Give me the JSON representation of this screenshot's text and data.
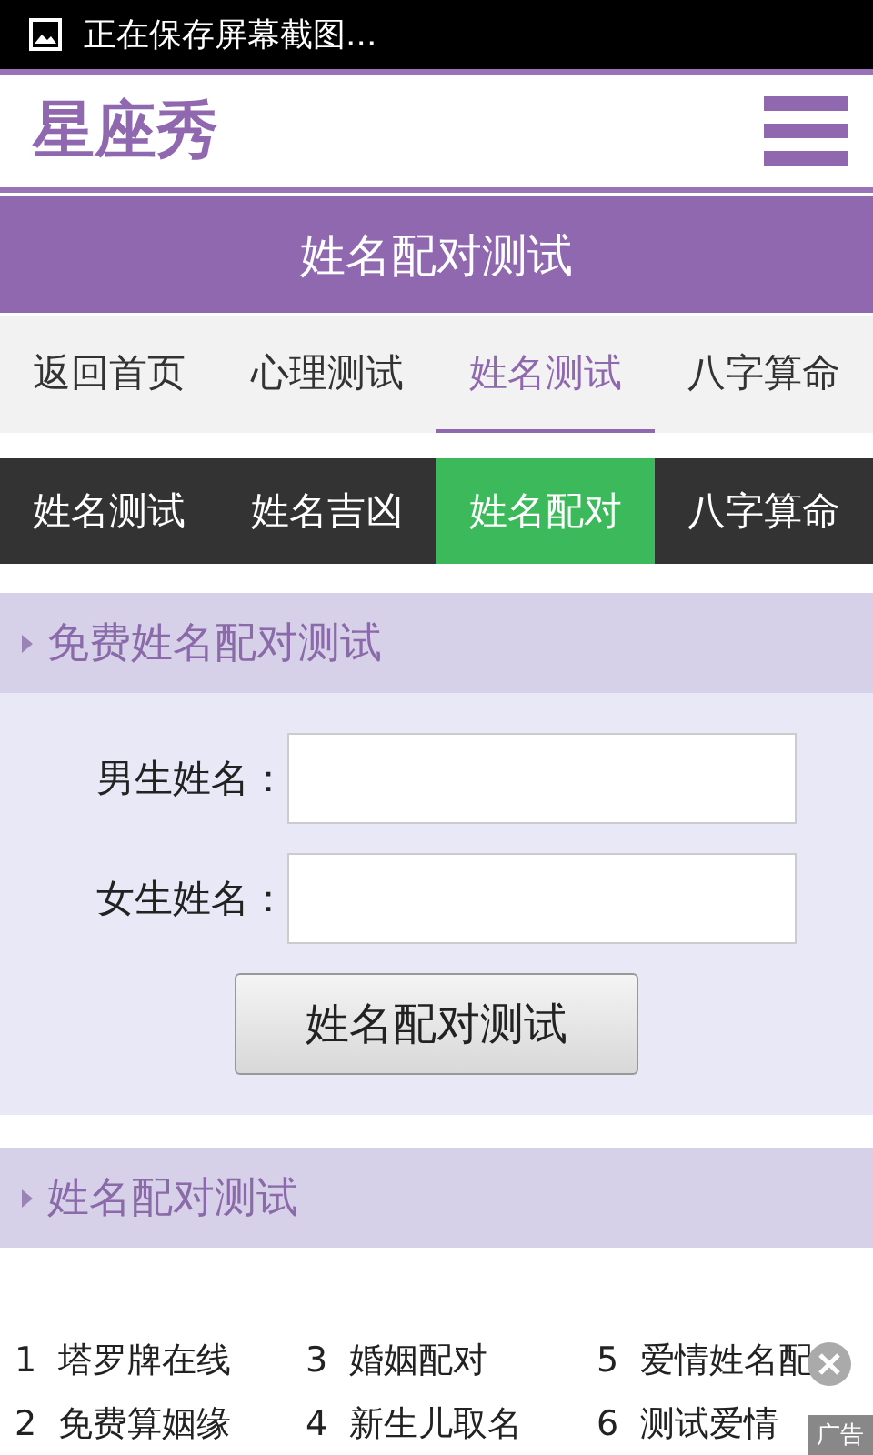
{
  "status_bar": {
    "notification": "正在保存屏幕截图..."
  },
  "header": {
    "logo": "星座秀"
  },
  "title": "姓名配对测试",
  "nav_tabs": [
    {
      "label": "返回首页",
      "selected": false
    },
    {
      "label": "心理测试",
      "selected": false
    },
    {
      "label": "姓名测试",
      "selected": true
    },
    {
      "label": "八字算命",
      "selected": false
    }
  ],
  "sub_tabs": [
    {
      "label": "姓名测试",
      "selected": false
    },
    {
      "label": "姓名吉凶",
      "selected": false
    },
    {
      "label": "姓名配对",
      "selected": true
    },
    {
      "label": "八字算命",
      "selected": false
    }
  ],
  "form_section": {
    "heading": "免费姓名配对测试",
    "fields": [
      {
        "label": "男生姓名："
      },
      {
        "label": "女生姓名："
      }
    ],
    "submit": "姓名配对测试"
  },
  "info_section": {
    "heading": "姓名配对测试"
  },
  "ad": {
    "items": [
      {
        "number": "1",
        "text": "塔罗牌在线"
      },
      {
        "number": "2",
        "text": "免费算姻缘"
      },
      {
        "number": "3",
        "text": "婚姻配对"
      },
      {
        "number": "4",
        "text": "新生儿取名"
      },
      {
        "number": "5",
        "text": "爱情姓名配"
      },
      {
        "number": "6",
        "text": "测试爱情"
      }
    ],
    "label": "广告"
  }
}
